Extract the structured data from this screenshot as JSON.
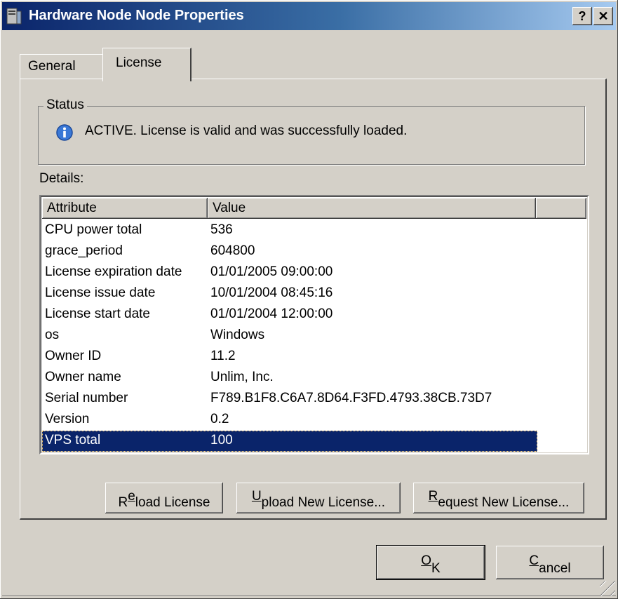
{
  "window": {
    "title": "Hardware Node Node Properties"
  },
  "titlebar_buttons": {
    "help": "?",
    "close": "✕"
  },
  "tabs": [
    {
      "label": "General"
    },
    {
      "label": "License"
    }
  ],
  "status": {
    "legend": "Status",
    "message": "ACTIVE. License is valid and was successfully loaded.",
    "icon": "info-icon"
  },
  "details": {
    "label": "Details:",
    "columns": [
      "Attribute",
      "Value"
    ],
    "rows": [
      {
        "attribute": "CPU power total",
        "value": "536"
      },
      {
        "attribute": "grace_period",
        "value": "604800"
      },
      {
        "attribute": "License expiration date",
        "value": "01/01/2005 09:00:00"
      },
      {
        "attribute": "License issue date",
        "value": "10/01/2004 08:45:16"
      },
      {
        "attribute": "License start date",
        "value": "01/01/2004 12:00:00"
      },
      {
        "attribute": "os",
        "value": "Windows"
      },
      {
        "attribute": "Owner ID",
        "value": "11.2"
      },
      {
        "attribute": "Owner name",
        "value": "Unlim, Inc."
      },
      {
        "attribute": "Serial number",
        "value": "F789.B1F8.C6A7.8D64.F3FD.4793.38CB.73D7"
      },
      {
        "attribute": "Version",
        "value": "0.2"
      },
      {
        "attribute": "VPS total",
        "value": "100"
      }
    ],
    "selected_row": "VPS total"
  },
  "buttons": {
    "reload": {
      "pre": "R",
      "ul": "e",
      "post": "load License"
    },
    "upload": {
      "pre": "",
      "ul": "U",
      "post": "pload New License..."
    },
    "request": {
      "pre": "",
      "ul": "R",
      "post": "equest New License..."
    },
    "ok": {
      "pre": "",
      "ul": "O",
      "post": "K"
    },
    "cancel": {
      "pre": "",
      "ul": "C",
      "post": "ancel"
    }
  },
  "colors": {
    "title_start": "#0a246a",
    "title_end": "#a6caf0",
    "selection": "#0a246a",
    "face": "#d4d0c8"
  }
}
